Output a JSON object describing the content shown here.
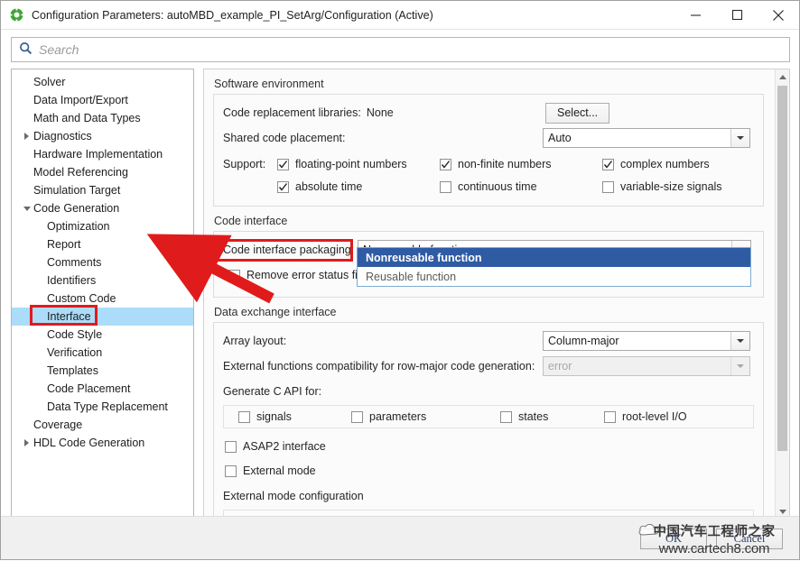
{
  "window": {
    "title": "Configuration Parameters: autoMBD_example_PI_SetArg/Configuration (Active)",
    "app_icon": "simulink-icon",
    "minimize_label": "—",
    "maximize_label": "□",
    "close_label": "✕"
  },
  "search": {
    "placeholder": "Search",
    "value": "",
    "icon": "search-icon"
  },
  "tree": {
    "items": [
      {
        "label": "Solver",
        "level": 0,
        "expander": "none",
        "selected": false
      },
      {
        "label": "Data Import/Export",
        "level": 0,
        "expander": "none",
        "selected": false
      },
      {
        "label": "Math and Data Types",
        "level": 0,
        "expander": "none",
        "selected": false
      },
      {
        "label": "Diagnostics",
        "level": 0,
        "expander": "collapsed",
        "selected": false
      },
      {
        "label": "Hardware Implementation",
        "level": 0,
        "expander": "none",
        "selected": false
      },
      {
        "label": "Model Referencing",
        "level": 0,
        "expander": "none",
        "selected": false
      },
      {
        "label": "Simulation Target",
        "level": 0,
        "expander": "none",
        "selected": false
      },
      {
        "label": "Code Generation",
        "level": 0,
        "expander": "expanded",
        "selected": false
      },
      {
        "label": "Optimization",
        "level": 1,
        "expander": "none",
        "selected": false
      },
      {
        "label": "Report",
        "level": 1,
        "expander": "none",
        "selected": false
      },
      {
        "label": "Comments",
        "level": 1,
        "expander": "none",
        "selected": false
      },
      {
        "label": "Identifiers",
        "level": 1,
        "expander": "none",
        "selected": false
      },
      {
        "label": "Custom Code",
        "level": 1,
        "expander": "none",
        "selected": false
      },
      {
        "label": "Interface",
        "level": 1,
        "expander": "none",
        "selected": true
      },
      {
        "label": "Code Style",
        "level": 1,
        "expander": "none",
        "selected": false
      },
      {
        "label": "Verification",
        "level": 1,
        "expander": "none",
        "selected": false
      },
      {
        "label": "Templates",
        "level": 1,
        "expander": "none",
        "selected": false
      },
      {
        "label": "Code Placement",
        "level": 1,
        "expander": "none",
        "selected": false
      },
      {
        "label": "Data Type Replacement",
        "level": 1,
        "expander": "none",
        "selected": false
      },
      {
        "label": "Coverage",
        "level": 0,
        "expander": "none",
        "selected": false
      },
      {
        "label": "HDL Code Generation",
        "level": 0,
        "expander": "collapsed",
        "selected": false
      }
    ]
  },
  "software_environment": {
    "title": "Software environment",
    "code_replacement_libraries_label": "Code replacement libraries:",
    "code_replacement_libraries_value": "None",
    "select_button": "Select...",
    "shared_code_placement_label": "Shared code placement:",
    "shared_code_placement_value": "Auto",
    "support_label": "Support:",
    "support_checkboxes": [
      {
        "label": "floating-point numbers",
        "checked": true
      },
      {
        "label": "non-finite numbers",
        "checked": true
      },
      {
        "label": "complex numbers",
        "checked": true
      },
      {
        "label": "absolute time",
        "checked": true
      },
      {
        "label": "continuous time",
        "checked": false
      },
      {
        "label": "variable-size signals",
        "checked": false
      }
    ]
  },
  "code_interface": {
    "title": "Code interface",
    "packaging_label": "Code interface packaging:",
    "packaging_value": "Nonreusable function",
    "packaging_options": [
      {
        "label": "Nonreusable function",
        "highlighted": true
      },
      {
        "label": "Reusable function",
        "highlighted": false
      }
    ],
    "remove_error_status_label": "Remove error status fie",
    "remove_error_status_checked": false
  },
  "data_exchange_interface": {
    "title": "Data exchange interface",
    "array_layout_label": "Array layout:",
    "array_layout_value": "Column-major",
    "external_functions_label": "External functions compatibility for row-major code generation:",
    "external_functions_value": "error",
    "generate_c_api_label": "Generate C API for:",
    "c_api_checkboxes": [
      {
        "label": "signals",
        "checked": false
      },
      {
        "label": "parameters",
        "checked": false
      },
      {
        "label": "states",
        "checked": false
      },
      {
        "label": "root-level I/O",
        "checked": false
      }
    ],
    "asap2_label": "ASAP2 interface",
    "asap2_checked": false,
    "external_mode_label": "External mode",
    "external_mode_checked": false,
    "external_mode_config_title": "External mode configuration"
  },
  "footer": {
    "ok_label": "OK",
    "cancel_label": "Cancel"
  },
  "watermark": {
    "chinese": "中国汽车工程师之家",
    "url": "www.cartech8.com"
  },
  "colors": {
    "selection_blue": "#abdcfa",
    "dropdown_highlight": "#2f5ba4",
    "annotation_red": "#e01b1b",
    "accent_icon_green": "#3fa535"
  }
}
